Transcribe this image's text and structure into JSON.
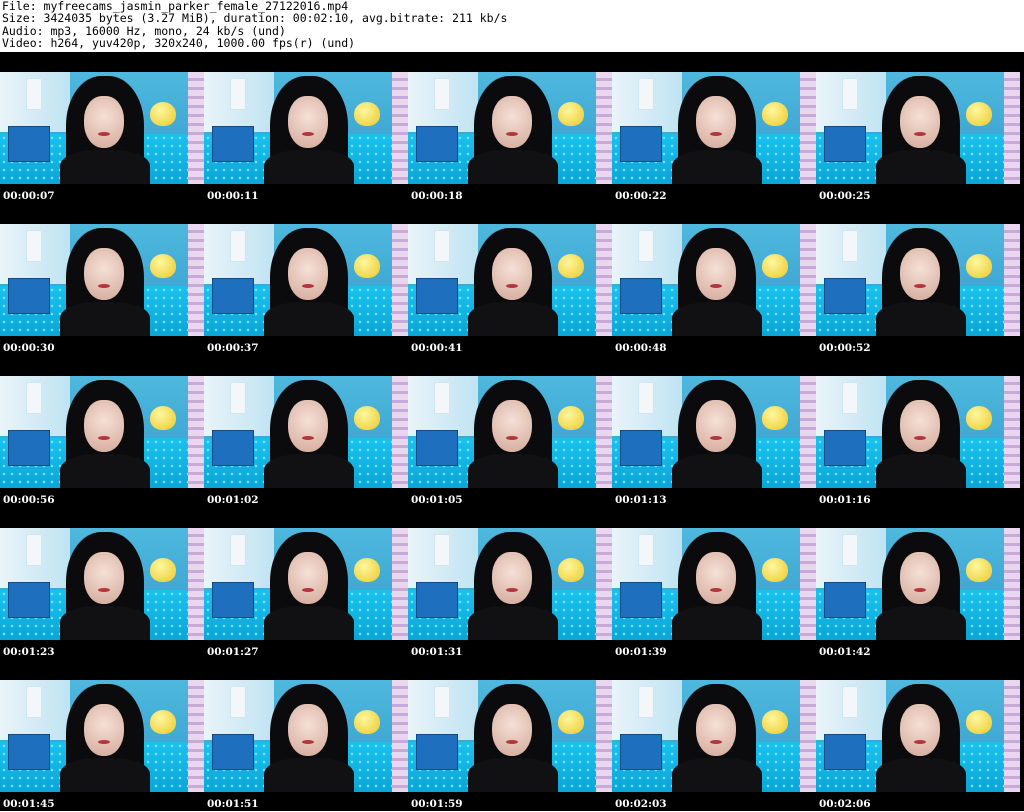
{
  "header": {
    "file_line": "File: myfreecams_jasmin_parker_female_27122016.mp4",
    "size_line": "Size: 3424035 bytes (3.27 MiB), duration: 00:02:10, avg.bitrate: 211 kb/s",
    "audio_line": "Audio: mp3, 16000 Hz, mono, 24 kb/s (und)",
    "video_line": "Video: h264, yuv420p, 320x240, 1000.00 fps(r) (und)"
  },
  "thumbnails": [
    {
      "timestamp": "00:00:07"
    },
    {
      "timestamp": "00:00:11"
    },
    {
      "timestamp": "00:00:18"
    },
    {
      "timestamp": "00:00:22"
    },
    {
      "timestamp": "00:00:25"
    },
    {
      "timestamp": "00:00:30"
    },
    {
      "timestamp": "00:00:37"
    },
    {
      "timestamp": "00:00:41"
    },
    {
      "timestamp": "00:00:48"
    },
    {
      "timestamp": "00:00:52"
    },
    {
      "timestamp": "00:00:56"
    },
    {
      "timestamp": "00:01:02"
    },
    {
      "timestamp": "00:01:05"
    },
    {
      "timestamp": "00:01:13"
    },
    {
      "timestamp": "00:01:16"
    },
    {
      "timestamp": "00:01:23"
    },
    {
      "timestamp": "00:01:27"
    },
    {
      "timestamp": "00:01:31"
    },
    {
      "timestamp": "00:01:39"
    },
    {
      "timestamp": "00:01:42"
    },
    {
      "timestamp": "00:01:45"
    },
    {
      "timestamp": "00:01:51"
    },
    {
      "timestamp": "00:01:59"
    },
    {
      "timestamp": "00:02:03"
    },
    {
      "timestamp": "00:02:06"
    }
  ],
  "colors": {
    "background": "#000000",
    "header_background": "#ffffff",
    "timestamp_text": "#ffffff"
  }
}
